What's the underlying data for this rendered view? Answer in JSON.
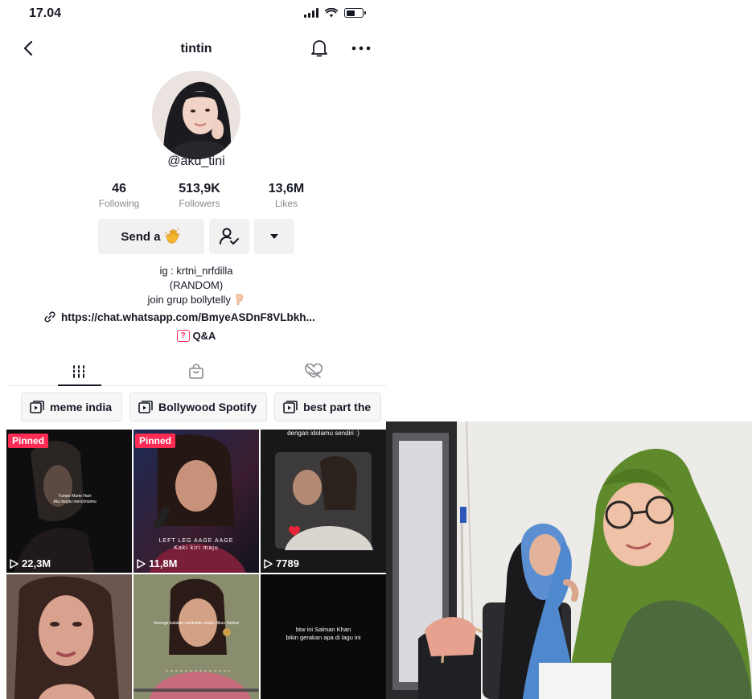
{
  "status_bar": {
    "time": "17.04"
  },
  "nav": {
    "title": "tintin"
  },
  "profile": {
    "handle": "@aku_tini",
    "stats": [
      {
        "value": "46",
        "label": "Following"
      },
      {
        "value": "513,9K",
        "label": "Followers"
      },
      {
        "value": "13,6M",
        "label": "Likes"
      }
    ],
    "send_button_label": "Send a",
    "bio_lines": [
      "ig : krtni_nrfdilla",
      "(RANDOM)",
      "join grup bollytelly"
    ],
    "link": "https://chat.whatsapp.com/BmyeASDnF8VLbkh...",
    "qa_label": "Q&A",
    "qa_icon_glyph": "?"
  },
  "playlists": [
    "meme india",
    "Bollywood Spotify",
    "best part the"
  ],
  "videos": [
    {
      "pinned_label": "Pinned",
      "views": "22,3M",
      "caption": "Tumpe Marte Hain\nAku begitu mencintaimu"
    },
    {
      "pinned_label": "Pinned",
      "views": "11,8M",
      "caption": "LEFT LEG AAGE AAGE\nKaki kiri maju"
    },
    {
      "pinned_label": "",
      "views": "7789",
      "caption": "dengan idolamu sendiri :)"
    },
    {
      "pinned_label": "",
      "views": "",
      "caption": ""
    },
    {
      "pinned_label": "",
      "views": "",
      "caption": "Semoga kalakan cambukku selalu dikau Simbar"
    },
    {
      "pinned_label": "",
      "views": "",
      "caption": "btw ini Salman Khan\nbikin gerakan apa di lagu ini"
    }
  ],
  "colors": {
    "accent": "#fe2c55",
    "text": "#161823",
    "muted": "#8a8b91",
    "button_bg": "#f1f1f2"
  },
  "icons": {
    "back": "chevron-left-icon",
    "bell": "bell-icon",
    "more": "more-dots-icon",
    "follow_status": "person-check-icon",
    "dropdown": "caret-down-icon",
    "link": "link-icon",
    "tab_videos": "grid-icon",
    "tab_shop": "shopping-bag-icon",
    "tab_liked": "hidden-heart-icon",
    "playlist": "playlist-icon",
    "play": "play-icon"
  }
}
